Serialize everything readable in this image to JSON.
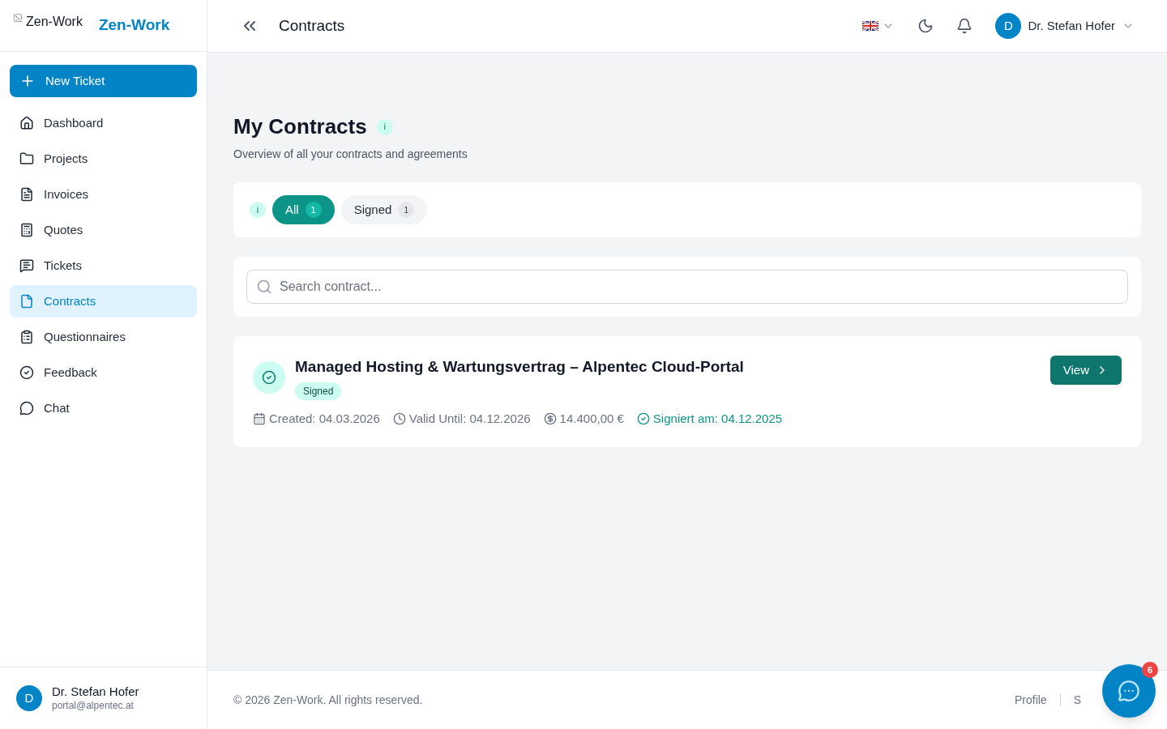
{
  "brand": {
    "logo_alt": "Zen-Work",
    "name": "Zen-Work"
  },
  "sidebar": {
    "new_button": "New Ticket",
    "items": [
      {
        "label": "Dashboard",
        "selected": false
      },
      {
        "label": "Projects",
        "selected": false
      },
      {
        "label": "Invoices",
        "selected": false
      },
      {
        "label": "Quotes",
        "selected": false
      },
      {
        "label": "Tickets",
        "selected": false
      },
      {
        "label": "Contracts",
        "selected": true
      },
      {
        "label": "Questionnaires",
        "selected": false
      },
      {
        "label": "Feedback",
        "selected": false
      },
      {
        "label": "Chat",
        "selected": false
      }
    ],
    "user": {
      "initial": "D",
      "name": "Dr. Stefan Hofer",
      "email": "portal@alpentec.at"
    }
  },
  "header": {
    "title": "Contracts",
    "user": {
      "initial": "D",
      "name": "Dr. Stefan Hofer"
    }
  },
  "page": {
    "title": "My Contracts",
    "info": "i",
    "subtitle": "Overview of all your contracts and agreements"
  },
  "filters": {
    "info": "i",
    "tabs": [
      {
        "label": "All",
        "count": "1",
        "selected": true
      },
      {
        "label": "Signed",
        "count": "1",
        "selected": false
      }
    ]
  },
  "search": {
    "placeholder": "Search contract..."
  },
  "contracts": [
    {
      "title": "Managed Hosting & Wartungsvertrag – Alpentec Cloud-Portal",
      "status": "Signed",
      "action": "View",
      "meta": [
        {
          "kind": "created",
          "text": "Created: 04.03.2026"
        },
        {
          "kind": "valid",
          "text": "Valid Until: 04.12.2026"
        },
        {
          "kind": "amount",
          "text": "14.400,00 €"
        },
        {
          "kind": "signed",
          "text": "Signiert am: 04.12.2025"
        }
      ]
    }
  ],
  "footer": {
    "copyright": "© 2026 Zen-Work. All rights reserved.",
    "links": [
      "Profile",
      "S"
    ]
  },
  "chat_button": {
    "badge": "6"
  }
}
